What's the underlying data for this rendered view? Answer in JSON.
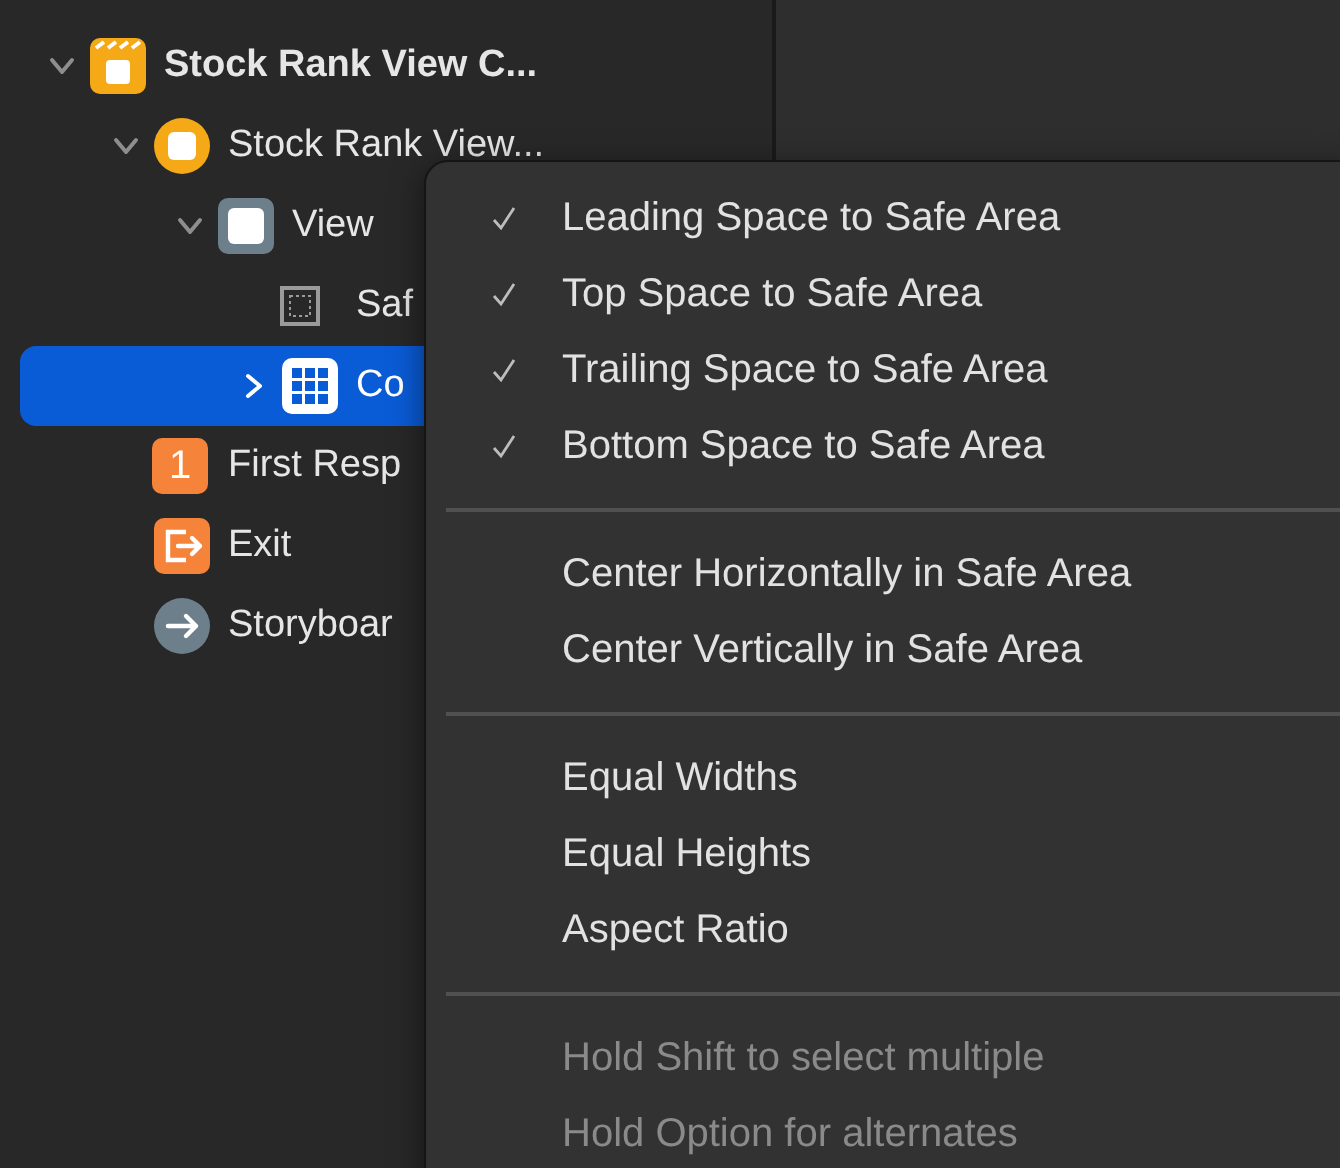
{
  "outline": [
    {
      "label": "Stock Rank View C...",
      "kind": "scene",
      "expanded": true,
      "selected": false,
      "children": [
        {
          "label": "Stock Rank View...",
          "kind": "controller",
          "expanded": true,
          "selected": false,
          "children": [
            {
              "label": "View",
              "kind": "view",
              "expanded": true,
              "selected": false,
              "children": [
                {
                  "label": "Saf",
                  "kind": "safe-area",
                  "selected": false
                },
                {
                  "label": "Co",
                  "kind": "collection",
                  "expanded": false,
                  "selected": true
                }
              ]
            }
          ]
        },
        {
          "label": "First Resp",
          "kind": "first-responder",
          "badge": "1",
          "selected": false
        },
        {
          "label": "Exit",
          "kind": "exit",
          "selected": false
        },
        {
          "label": "Storyboar",
          "kind": "entry",
          "selected": false
        }
      ]
    }
  ],
  "menu": {
    "sections": [
      {
        "items": [
          {
            "label": "Leading Space to Safe Area",
            "checked": true,
            "disabled": false
          },
          {
            "label": "Top Space to Safe Area",
            "checked": true,
            "disabled": false
          },
          {
            "label": "Trailing Space to Safe Area",
            "checked": true,
            "disabled": false
          },
          {
            "label": "Bottom Space to Safe Area",
            "checked": true,
            "disabled": false
          }
        ]
      },
      {
        "items": [
          {
            "label": "Center Horizontally in Safe Area",
            "checked": false,
            "disabled": false
          },
          {
            "label": "Center Vertically in Safe Area",
            "checked": false,
            "disabled": false
          }
        ]
      },
      {
        "items": [
          {
            "label": "Equal Widths",
            "checked": false,
            "disabled": false
          },
          {
            "label": "Equal Heights",
            "checked": false,
            "disabled": false
          },
          {
            "label": "Aspect Ratio",
            "checked": false,
            "disabled": false
          }
        ]
      },
      {
        "items": [
          {
            "label": "Hold Shift to select multiple",
            "checked": false,
            "disabled": true
          },
          {
            "label": "Hold Option for alternates",
            "checked": false,
            "disabled": true
          }
        ]
      }
    ]
  }
}
